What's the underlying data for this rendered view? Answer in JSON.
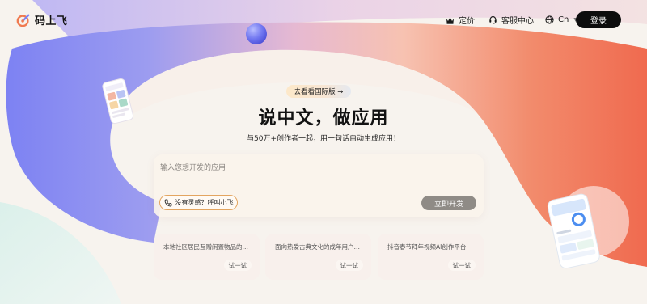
{
  "header": {
    "brand_name": "码上飞",
    "nav": {
      "pricing_label": "定价",
      "service_label": "客服中心",
      "language_label": "Cn"
    },
    "login_label": "登录"
  },
  "hero": {
    "intl_pill_label": "去看看国际版 →",
    "title": "说中文，做应用",
    "subtitle": "与50万+创作者一起，用一句话自动生成应用！"
  },
  "prompt": {
    "placeholder": "输入您想开发的应用",
    "value": "",
    "voice_button_label": "没有灵感？呼叫小飞",
    "submit_label": "立即开发"
  },
  "suggestions": [
    {
      "text": "本地社区居民互赠闲置物品的平...",
      "try_label": "试一试"
    },
    {
      "text": "面向热爱古典文化的成年用户，...",
      "try_label": "试一试"
    },
    {
      "text": "抖音春节拜年视频AI创作平台",
      "try_label": "试一试"
    }
  ],
  "icons": {
    "logo": "codefly-logo-icon",
    "pricing": "crown-icon",
    "service": "headset-icon",
    "language": "globe-icon",
    "language_caret": "caret-down-icon",
    "voice": "phone-icon"
  },
  "colors": {
    "brand_black": "#0d0d0d",
    "accent_orange": "#e3a560",
    "submit_disabled": "#8f8b86",
    "ribbon_blue": "#7f84f4",
    "ribbon_orange": "#f27a5a",
    "page_bg": "#f7f3ee"
  }
}
